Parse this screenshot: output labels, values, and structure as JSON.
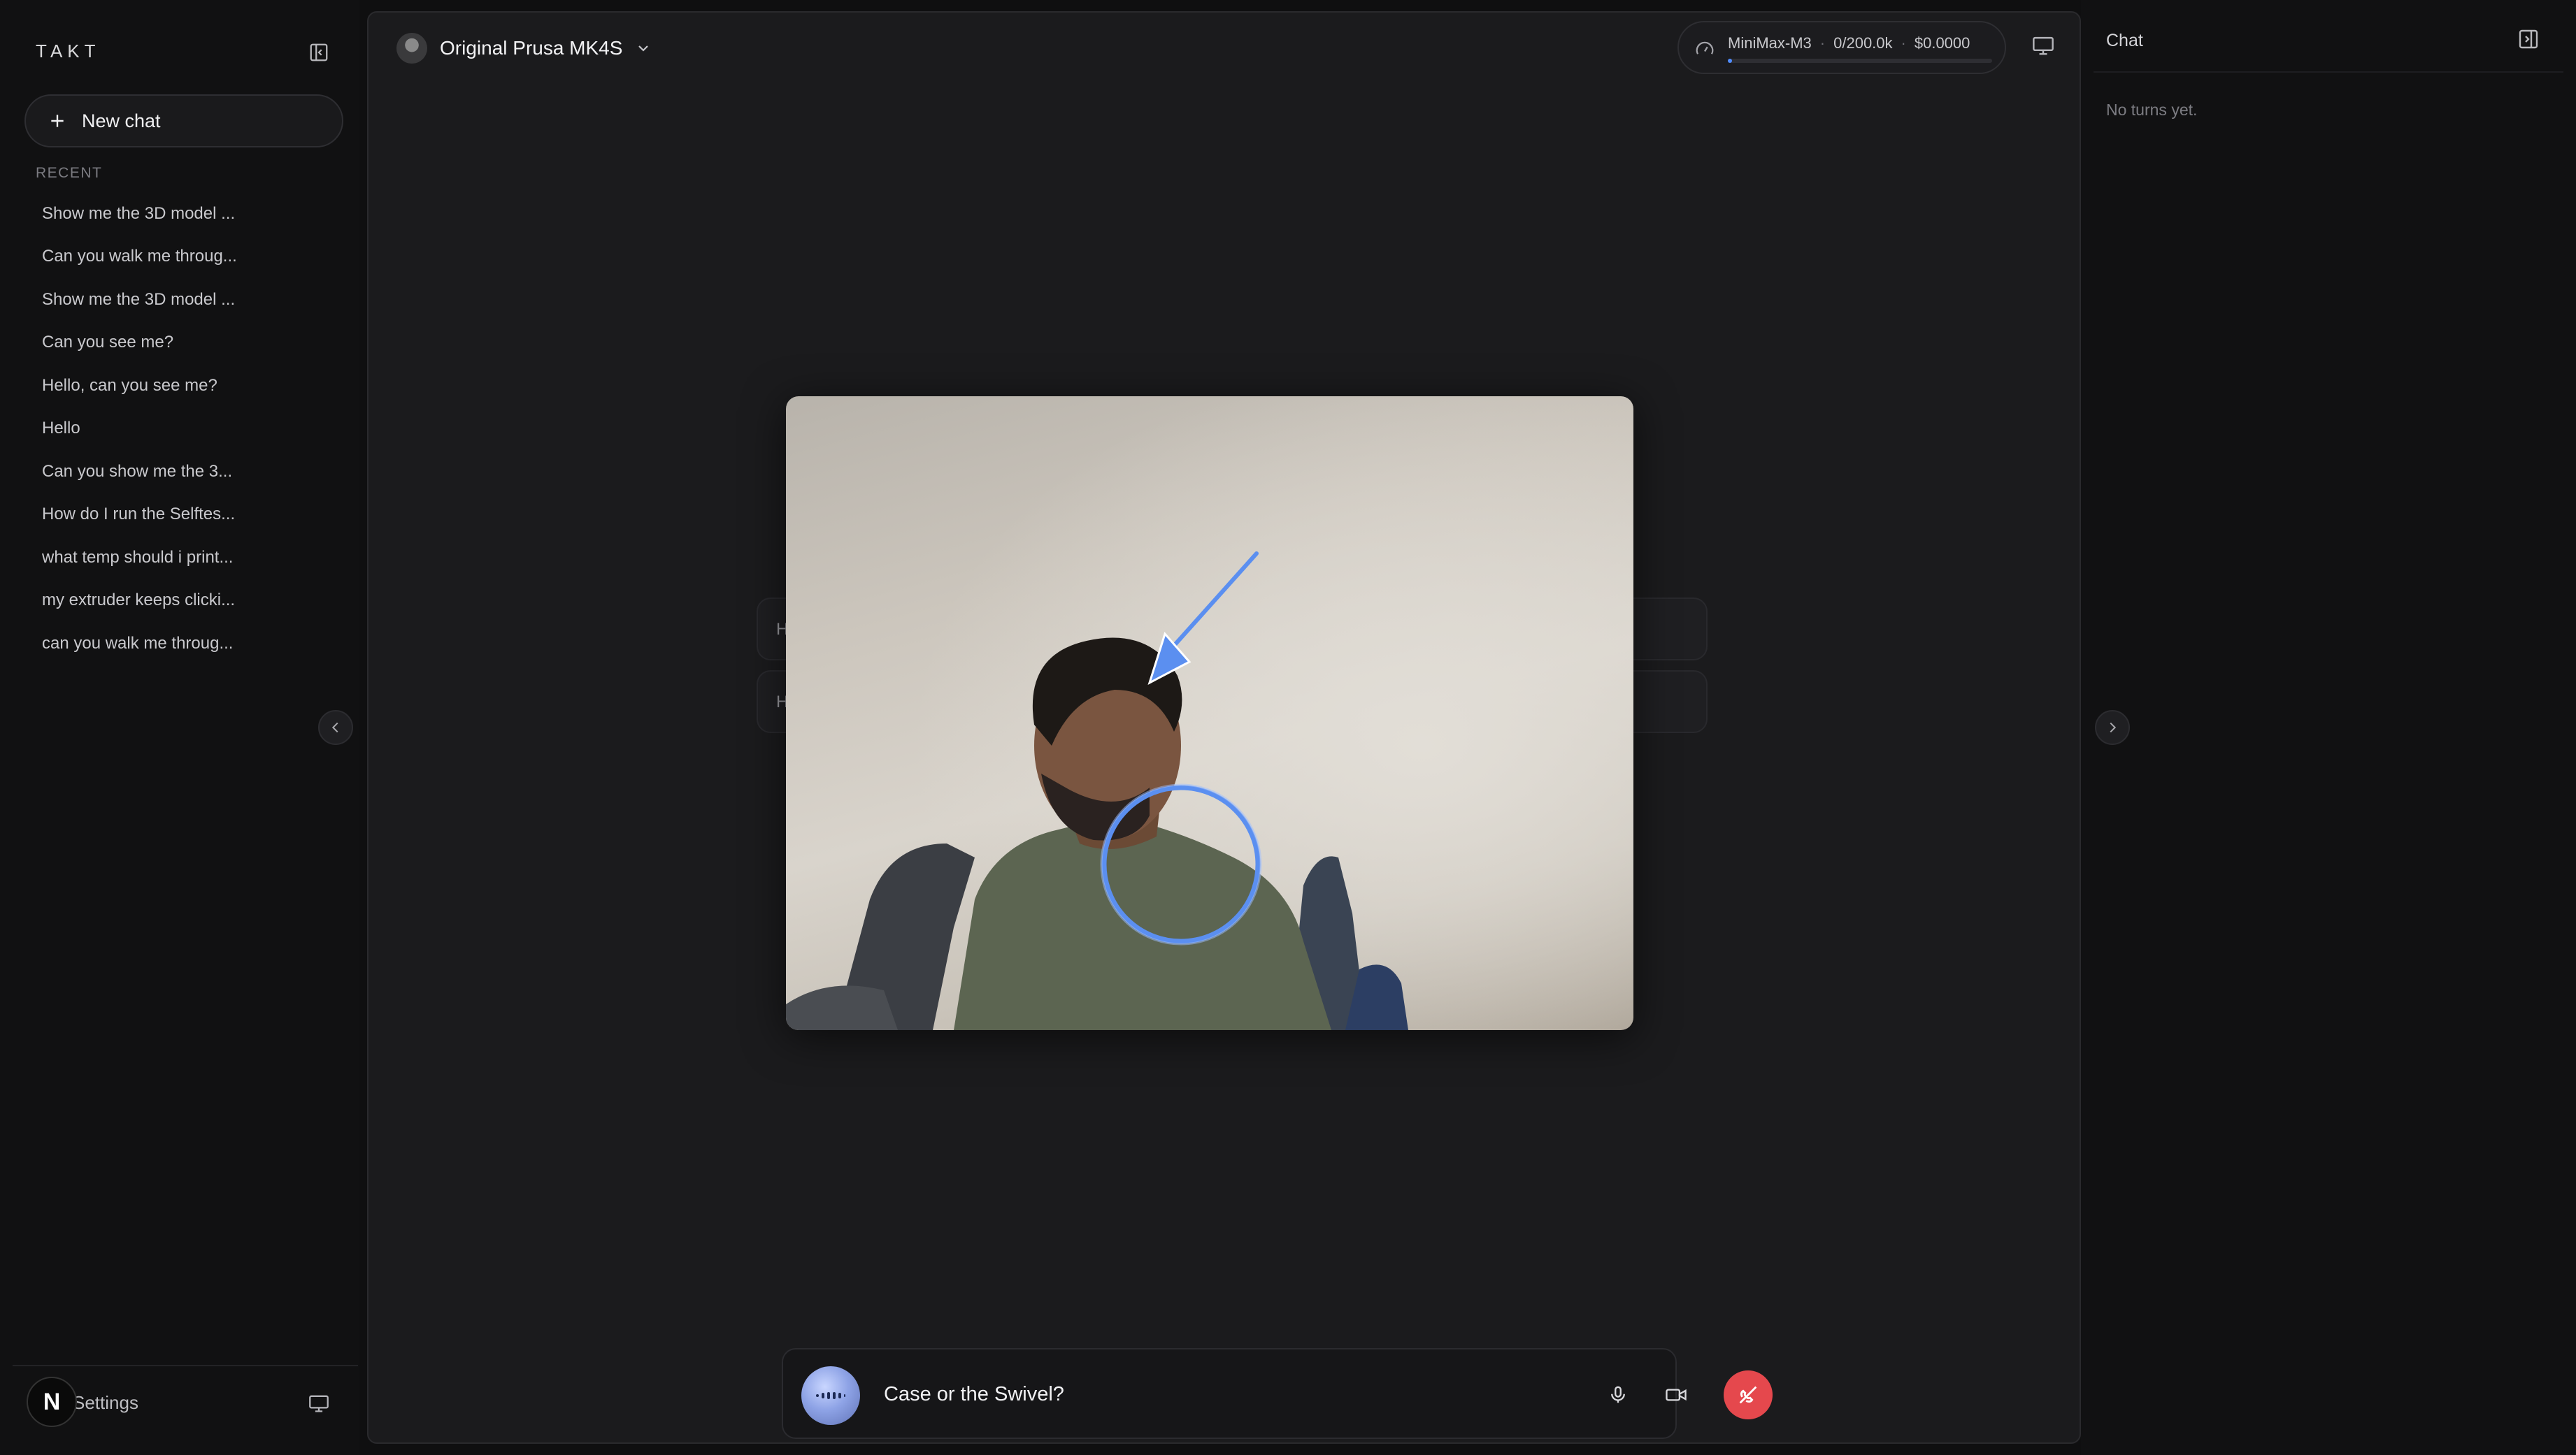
{
  "sidebar": {
    "brand": "TAKT",
    "new_chat_label": "New chat",
    "recent_label": "RECENT",
    "recent_items": [
      "Show me the 3D model ...",
      "Can you walk me throug...",
      "Show me the 3D model ...",
      "Can you see me?",
      "Hello, can you see me?",
      "Hello",
      "Can you show me the 3...",
      "How do I run the Selftes...",
      "what temp should i print...",
      "my extruder keeps clicki...",
      "can you walk me throug..."
    ],
    "avatar_letter": "N",
    "settings_label": "Settings"
  },
  "header": {
    "device_name": "Original Prusa MK4S",
    "model": "MiniMax-M3",
    "tokens": "0/200.0k",
    "cost": "$0.0000",
    "usage_fraction": 0.01
  },
  "main": {
    "ghost_rows": [
      "H",
      "H"
    ]
  },
  "voice": {
    "transcript": "Case or the Swivel?"
  },
  "chat_panel": {
    "title": "Chat",
    "empty_state": "No turns yet."
  },
  "colors": {
    "accent": "#4f8cff",
    "hangup": "#e5484d",
    "annotation": "#5b8ff0"
  },
  "icons": {
    "collapse_sidebar": "panel-left-close-icon",
    "new_chat": "plus-icon",
    "device_dropdown": "chevron-down-icon",
    "gauge": "gauge-icon",
    "screen_share": "monitor-icon",
    "mic": "microphone-icon",
    "camera": "video-camera-icon",
    "hangup": "phone-off-icon",
    "right_panel": "panel-right-icon"
  }
}
